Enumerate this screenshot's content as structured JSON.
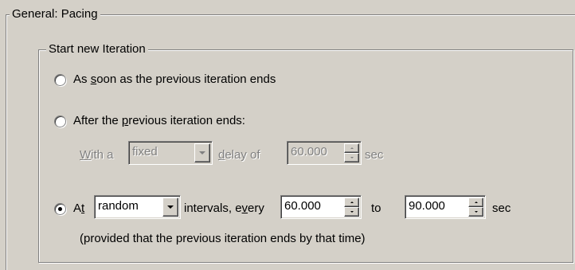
{
  "group_general": {
    "title": "General: Pacing"
  },
  "group_start": {
    "title": "Start new Iteration"
  },
  "option_asap": {
    "label_pre": "As ",
    "label_u": "s",
    "label_post": "oon as the previous iteration ends",
    "selected": false
  },
  "option_after": {
    "label_pre": "After the ",
    "label_u": "p",
    "label_post": "revious iteration ends:",
    "selected": false,
    "with_u": "W",
    "with_post": "ith a",
    "delay_type": "fixed",
    "delay_u": "d",
    "delay_post": "elay of",
    "delay_value": "60.000",
    "unit": "sec"
  },
  "option_at": {
    "label_pre": "A",
    "label_u": "t",
    "selected": true,
    "interval_type": "random",
    "intervals_pre": "intervals, e",
    "intervals_u": "v",
    "intervals_post": "ery",
    "min_value": "60.000",
    "to_label": "to",
    "max_value": "90.000",
    "unit": "sec",
    "note": "(provided that the previous iteration ends by that time)"
  }
}
